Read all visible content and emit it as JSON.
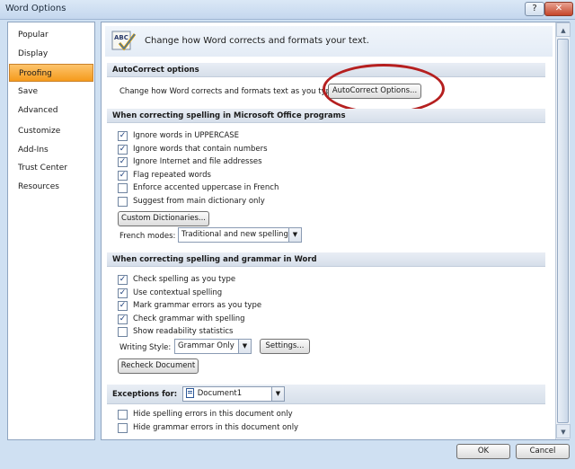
{
  "window": {
    "title": "Word Options",
    "help_label": "?",
    "close_label": "✕"
  },
  "sidebar": {
    "items": [
      {
        "label": "Popular"
      },
      {
        "label": "Display"
      },
      {
        "label": "Proofing"
      },
      {
        "label": "Save"
      },
      {
        "label": "Advanced"
      },
      {
        "label": "Customize"
      },
      {
        "label": "Add-Ins"
      },
      {
        "label": "Trust Center"
      },
      {
        "label": "Resources"
      }
    ],
    "active": "Proofing"
  },
  "header": {
    "text": "Change how Word corrects and formats your text.",
    "icon": "abc-check-icon"
  },
  "autocorrect": {
    "section_title": "AutoCorrect options",
    "description": "Change how Word corrects and formats text as you type:",
    "button_label": "AutoCorrect Options..."
  },
  "spelling_office": {
    "section_title": "When correcting spelling in Microsoft Office programs",
    "options": [
      {
        "label": "Ignore words in UPPERCASE",
        "checked": true
      },
      {
        "label": "Ignore words that contain numbers",
        "checked": true
      },
      {
        "label": "Ignore Internet and file addresses",
        "checked": true
      },
      {
        "label": "Flag repeated words",
        "checked": true
      },
      {
        "label": "Enforce accented uppercase in French",
        "checked": false
      },
      {
        "label": "Suggest from main dictionary only",
        "checked": false
      }
    ],
    "custom_dictionaries_label": "Custom Dictionaries...",
    "french_modes_label": "French modes:",
    "french_modes_value": "Traditional and new spellings"
  },
  "spelling_word": {
    "section_title": "When correcting spelling and grammar in Word",
    "options": [
      {
        "label": "Check spelling as you type",
        "checked": true
      },
      {
        "label": "Use contextual spelling",
        "checked": true
      },
      {
        "label": "Mark grammar errors as you type",
        "checked": true
      },
      {
        "label": "Check grammar with spelling",
        "checked": true
      },
      {
        "label": "Show readability statistics",
        "checked": false
      }
    ],
    "writing_style_label": "Writing Style:",
    "writing_style_value": "Grammar Only",
    "settings_label": "Settings...",
    "recheck_label": "Recheck Document"
  },
  "exceptions": {
    "label": "Exceptions for:",
    "document_value": "Document1",
    "options": [
      {
        "label": "Hide spelling errors in this document only",
        "checked": false
      },
      {
        "label": "Hide grammar errors in this document only",
        "checked": false
      }
    ]
  },
  "footer": {
    "ok_label": "OK",
    "cancel_label": "Cancel"
  },
  "colors": {
    "active_nav": "#f59b1c",
    "highlight_circle": "#b51f1f"
  }
}
